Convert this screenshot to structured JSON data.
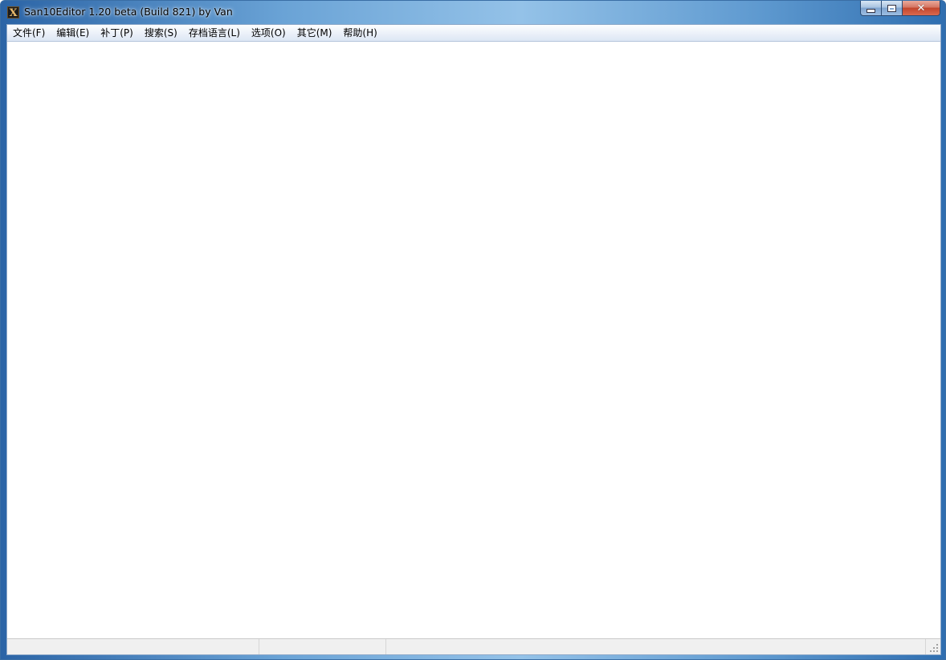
{
  "window": {
    "title": "San10Editor 1.20 beta (Build 821) by Van",
    "app_icon_glyph": "X"
  },
  "caption_buttons": {
    "minimize_icon": "minimize-icon",
    "maximize_icon": "maximize-icon",
    "close_icon": "close-icon",
    "close_glyph": "✕"
  },
  "menubar": {
    "items": [
      {
        "label": "文件(F)"
      },
      {
        "label": "编辑(E)"
      },
      {
        "label": "补丁(P)"
      },
      {
        "label": "搜索(S)"
      },
      {
        "label": "存档语言(L)"
      },
      {
        "label": "选项(O)"
      },
      {
        "label": "其它(M)"
      },
      {
        "label": "帮助(H)"
      }
    ]
  },
  "statusbar": {
    "panes": [
      "",
      "",
      ""
    ]
  },
  "colors": {
    "close_button": "#c2452c",
    "window_frame": "#6aa3d6",
    "client_background": "#ffffff"
  }
}
